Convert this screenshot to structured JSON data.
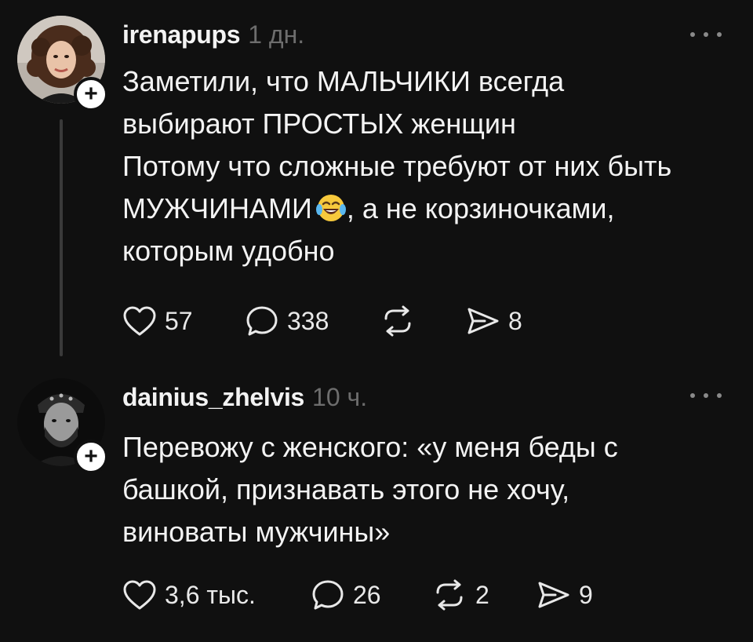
{
  "posts": [
    {
      "username": "irenapups",
      "time": "1 дн.",
      "text_lines": [
        "Заметили, что МАЛЬЧИКИ всегда",
        "выбирают ПРОСТЫХ женщин",
        "Потому что сложные требуют от них быть",
        "МУЖЧИНАМИ",
        ", а не корзиночками,",
        "которым удобно"
      ],
      "emoji": "laughing-tears-emoji",
      "likes": "57",
      "comments": "338",
      "reposts": "",
      "shares": "8"
    },
    {
      "username": "dainius_zhelvis",
      "time": "10 ч.",
      "text_lines": [
        "Перевожу с женского: «у меня беды с",
        "башкой, признавать этого не хочу,",
        "виноваты мужчины»"
      ],
      "likes": "3,6 тыс.",
      "comments": "26",
      "reposts": "2",
      "shares": "9"
    }
  ],
  "icons": {
    "like": "heart-icon",
    "comment": "comment-bubble-icon",
    "repost": "repost-icon",
    "share": "send-icon",
    "follow": "plus-icon",
    "more": "more-dots-icon"
  },
  "follow_symbol": "+",
  "colors": {
    "background": "#101010",
    "text": "#f3f3f3",
    "muted": "#6d6d6d",
    "thread": "#3a3a3a"
  }
}
